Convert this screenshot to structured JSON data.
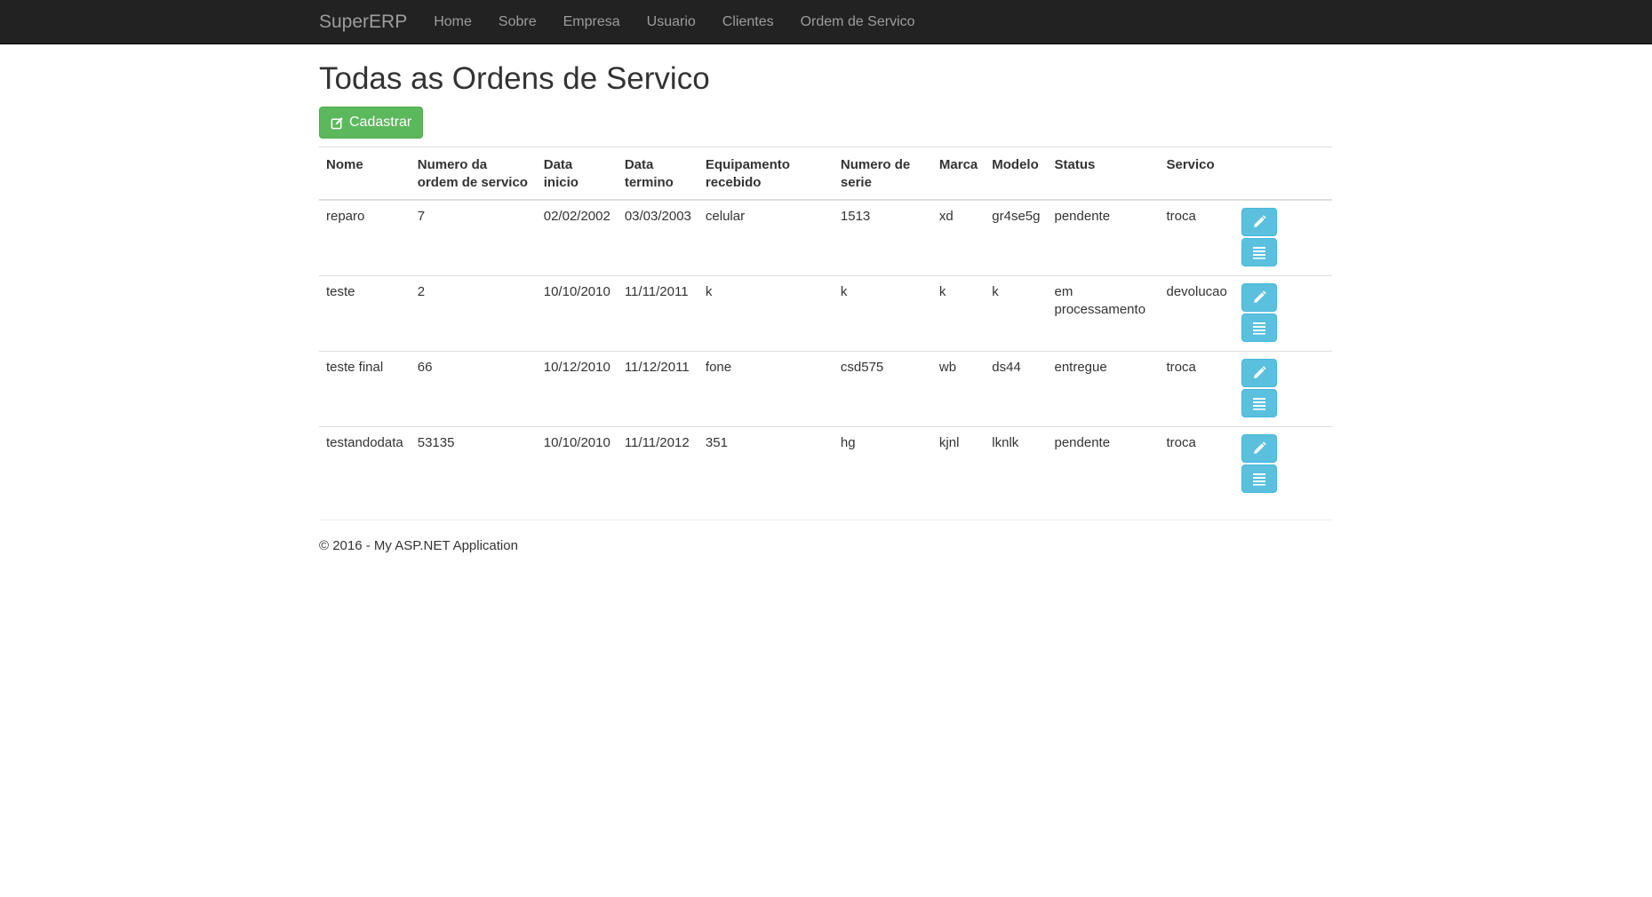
{
  "navbar": {
    "brand": "SuperERP",
    "links": [
      "Home",
      "Sobre",
      "Empresa",
      "Usuario",
      "Clientes",
      "Ordem de Servico"
    ]
  },
  "page": {
    "title": "Todas as Ordens de Servico",
    "create_button": "Cadastrar"
  },
  "table": {
    "headers": {
      "nome": "Nome",
      "numero": "Numero da ordem de servico",
      "data_inicio": "Data inicio",
      "data_termino": "Data termino",
      "equipamento": "Equipamento recebido",
      "serie": "Numero de serie",
      "marca": "Marca",
      "modelo": "Modelo",
      "status": "Status",
      "servico": "Servico"
    },
    "rows": [
      {
        "nome": "reparo",
        "numero": "7",
        "data_inicio": "02/02/2002",
        "data_termino": "03/03/2003",
        "equipamento": "celular",
        "serie": "1513",
        "marca": "xd",
        "modelo": "gr4se5g",
        "status": "pendente",
        "servico": "troca"
      },
      {
        "nome": "teste",
        "numero": "2",
        "data_inicio": "10/10/2010",
        "data_termino": "11/11/2011",
        "equipamento": "k",
        "serie": "k",
        "marca": "k",
        "modelo": "k",
        "status": "em processamento",
        "servico": "devolucao"
      },
      {
        "nome": "teste final",
        "numero": "66",
        "data_inicio": "10/12/2010",
        "data_termino": "11/12/2011",
        "equipamento": "fone",
        "serie": "csd575",
        "marca": "wb",
        "modelo": "ds44",
        "status": "entregue",
        "servico": "troca"
      },
      {
        "nome": "testandodata",
        "numero": "53135",
        "data_inicio": "10/10/2010",
        "data_termino": "11/11/2012",
        "equipamento": "351",
        "serie": "hg",
        "marca": "kjnl",
        "modelo": "lknlk",
        "status": "pendente",
        "servico": "troca"
      }
    ]
  },
  "footer": {
    "text": "© 2016 - My ASP.NET Application"
  },
  "icons": {
    "edit": "pencil-icon",
    "details": "list-icon",
    "create": "edit-square-icon"
  },
  "colors": {
    "navbar_bg": "#222222",
    "success": "#5cb85c",
    "info": "#5bc0de"
  }
}
